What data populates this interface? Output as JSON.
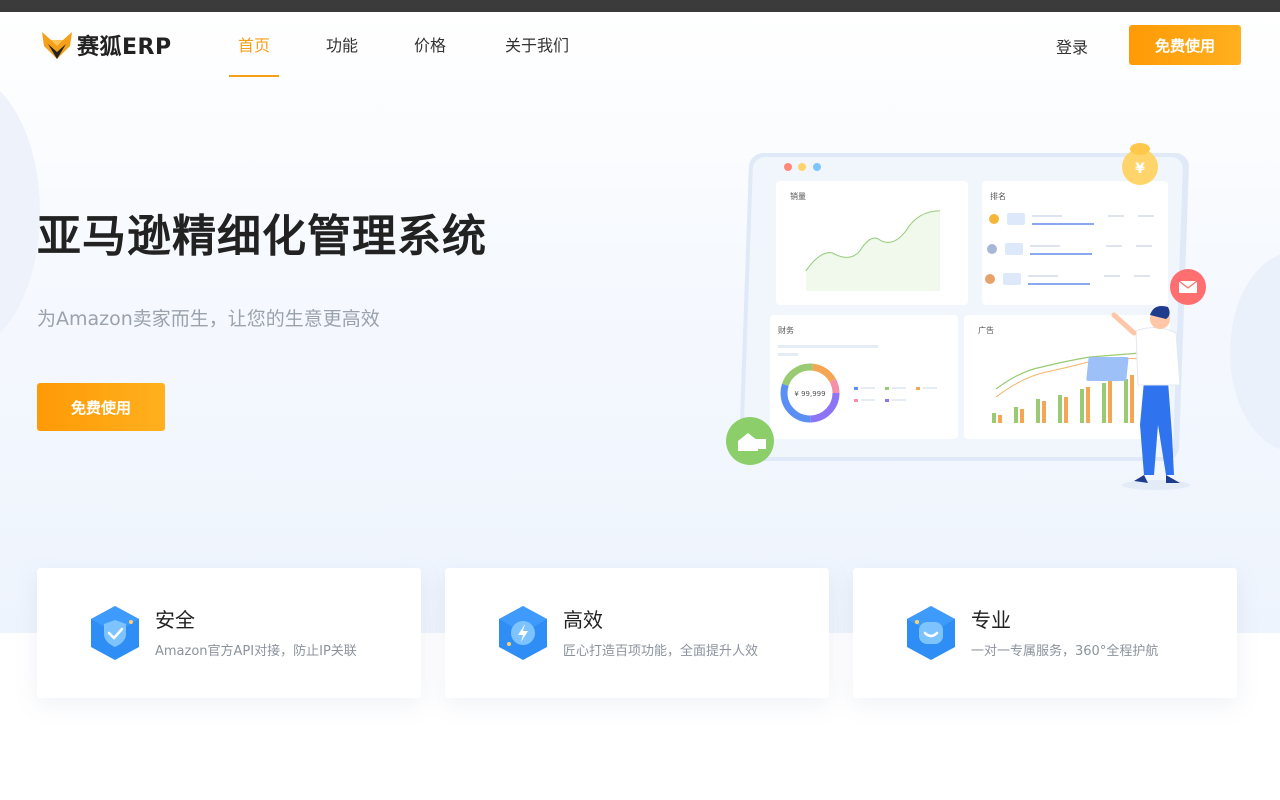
{
  "brand": {
    "name": "赛狐ERP"
  },
  "nav": {
    "items": [
      {
        "label": "首页",
        "active": true
      },
      {
        "label": "功能",
        "active": false
      },
      {
        "label": "价格",
        "active": false
      },
      {
        "label": "关于我们",
        "active": false
      }
    ],
    "login_label": "登录",
    "cta_label": "免费使用"
  },
  "hero": {
    "title": "亚马逊精细化管理系统",
    "subtitle": "为Amazon卖家而生，让您的生意更高效",
    "cta_label": "免费使用"
  },
  "illustration": {
    "panel_sales": "销量",
    "panel_ranking": "排名",
    "panel_finance": "财务",
    "panel_ads": "广告",
    "finance_amount": "¥ 99,999",
    "coin_symbol": "¥"
  },
  "features": [
    {
      "title": "安全",
      "desc": "Amazon官方API对接，防止IP关联",
      "icon": "shield-check-icon"
    },
    {
      "title": "高效",
      "desc": "匠心打造百项功能，全面提升人效",
      "icon": "lightning-icon"
    },
    {
      "title": "专业",
      "desc": "一对一专属服务，360°全程护航",
      "icon": "smile-chat-icon"
    }
  ],
  "colors": {
    "accent": "#f5a01a",
    "button": "#ff9e0a",
    "icon_blue": "#2f8ef5"
  }
}
